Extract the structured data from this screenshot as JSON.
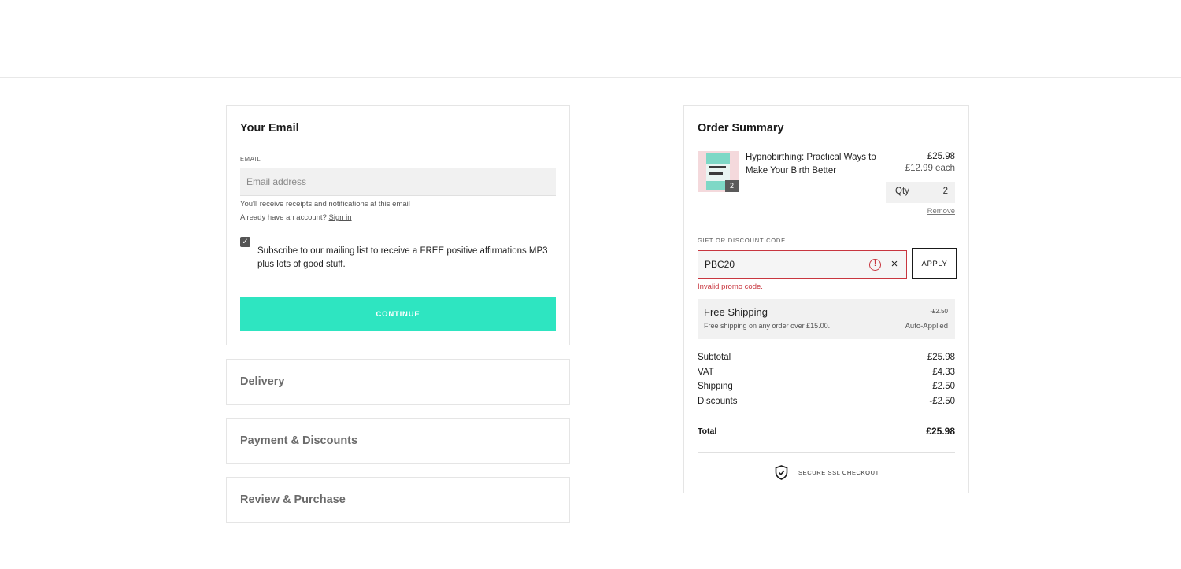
{
  "email_section": {
    "title": "Your Email",
    "field_label": "EMAIL",
    "placeholder": "Email address",
    "hint_receipts": "You'll receive receipts and notifications at this email",
    "hint_account": "Already have an account?",
    "sign_in_link": "Sign in",
    "subscribe_checked": true,
    "subscribe_text": "Subscribe to our mailing list to receive a FREE positive affirmations MP3 plus lots of good stuff.",
    "continue_label": "CONTINUE"
  },
  "sections": [
    {
      "label": "Delivery"
    },
    {
      "label": "Payment & Discounts"
    },
    {
      "label": "Review & Purchase"
    }
  ],
  "order_summary": {
    "title": "Order Summary",
    "item": {
      "name": "Hypnobirthing: Practical Ways to Make Your Birth Better",
      "price": "£25.98",
      "each": "£12.99 each",
      "badge_qty": "2",
      "qty_label": "Qty",
      "qty_value": "2",
      "remove_label": "Remove"
    },
    "discount": {
      "label": "GIFT OR DISCOUNT CODE",
      "value": "PBC20",
      "apply_label": "APPLY",
      "error": "Invalid promo code."
    },
    "promo": {
      "title": "Free Shipping",
      "description": "Free shipping on any order over £15.00.",
      "amount": "-£2.50",
      "status": "Auto-Applied"
    },
    "totals": [
      {
        "label": "Subtotal",
        "value": "£25.98"
      },
      {
        "label": "VAT",
        "value": "£4.33"
      },
      {
        "label": "Shipping",
        "value": "£2.50"
      },
      {
        "label": "Discounts",
        "value": "-£2.50"
      }
    ],
    "total": {
      "label": "Total",
      "value": "£25.98"
    },
    "secure_text": "SECURE SSL CHECKOUT"
  },
  "colors": {
    "accent": "#2ee5c1",
    "error": "#c8363f",
    "field_bg": "#f1f1f1"
  }
}
